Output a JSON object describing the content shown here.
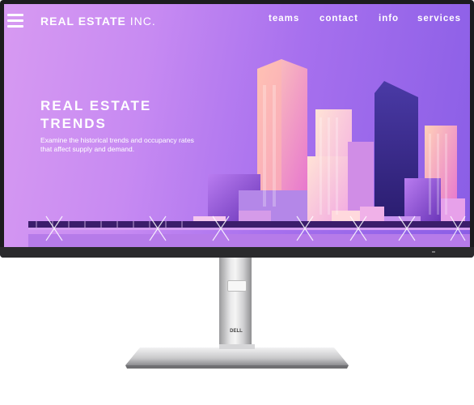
{
  "header": {
    "brand_bold": "REAL ESTATE",
    "brand_light": "INC.",
    "menu_icon": "hamburger-menu-icon",
    "nav": [
      {
        "label": "teams"
      },
      {
        "label": "contact"
      },
      {
        "label": "info"
      },
      {
        "label": "services"
      }
    ]
  },
  "hero": {
    "title_line1": "REAL ESTATE",
    "title_line2": "TRENDS",
    "subtitle": "Examine the historical trends and occupancy rates that affect supply and demand."
  },
  "device": {
    "brand_logo": "DELL"
  },
  "colors": {
    "accent_purple": "#8a5ee6",
    "accent_pink": "#d79af2",
    "bezel": "#1c1c1e"
  }
}
